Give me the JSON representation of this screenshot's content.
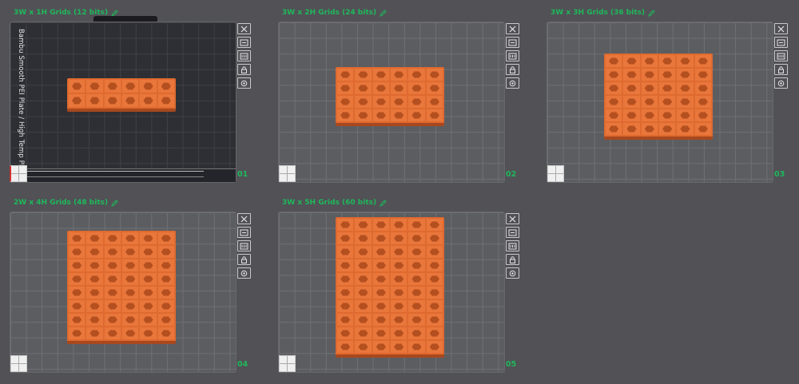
{
  "plates": [
    {
      "id": "p1",
      "title": "3W x 1H Grids (12 bits)",
      "number": "01",
      "cols": 6,
      "rows": 2,
      "dark": true,
      "vertical_label": "Bambu Smooth PEI Plate / High Temp Plate"
    },
    {
      "id": "p2",
      "title": "3W x 2H Grids (24 bits)",
      "number": "02",
      "cols": 6,
      "rows": 4,
      "dark": false
    },
    {
      "id": "p3",
      "title": "3W x 3H Grids (36 bits)",
      "number": "03",
      "cols": 6,
      "rows": 6,
      "dark": false
    },
    {
      "id": "p4",
      "title": "2W x 4H Grids (48 bits)",
      "number": "04",
      "cols": 6,
      "rows": 8,
      "dark": false
    },
    {
      "id": "p5",
      "title": "3W x 5H Grids (60 bits)",
      "number": "05",
      "cols": 6,
      "rows": 10,
      "dark": false
    }
  ],
  "plate_tools": [
    "close-icon",
    "auto-arrange-icon",
    "orient-icon",
    "lock-icon",
    "settings-icon"
  ],
  "colors": {
    "accent": "#1fb85a",
    "model": "#df6a2f",
    "background": "#515156"
  }
}
